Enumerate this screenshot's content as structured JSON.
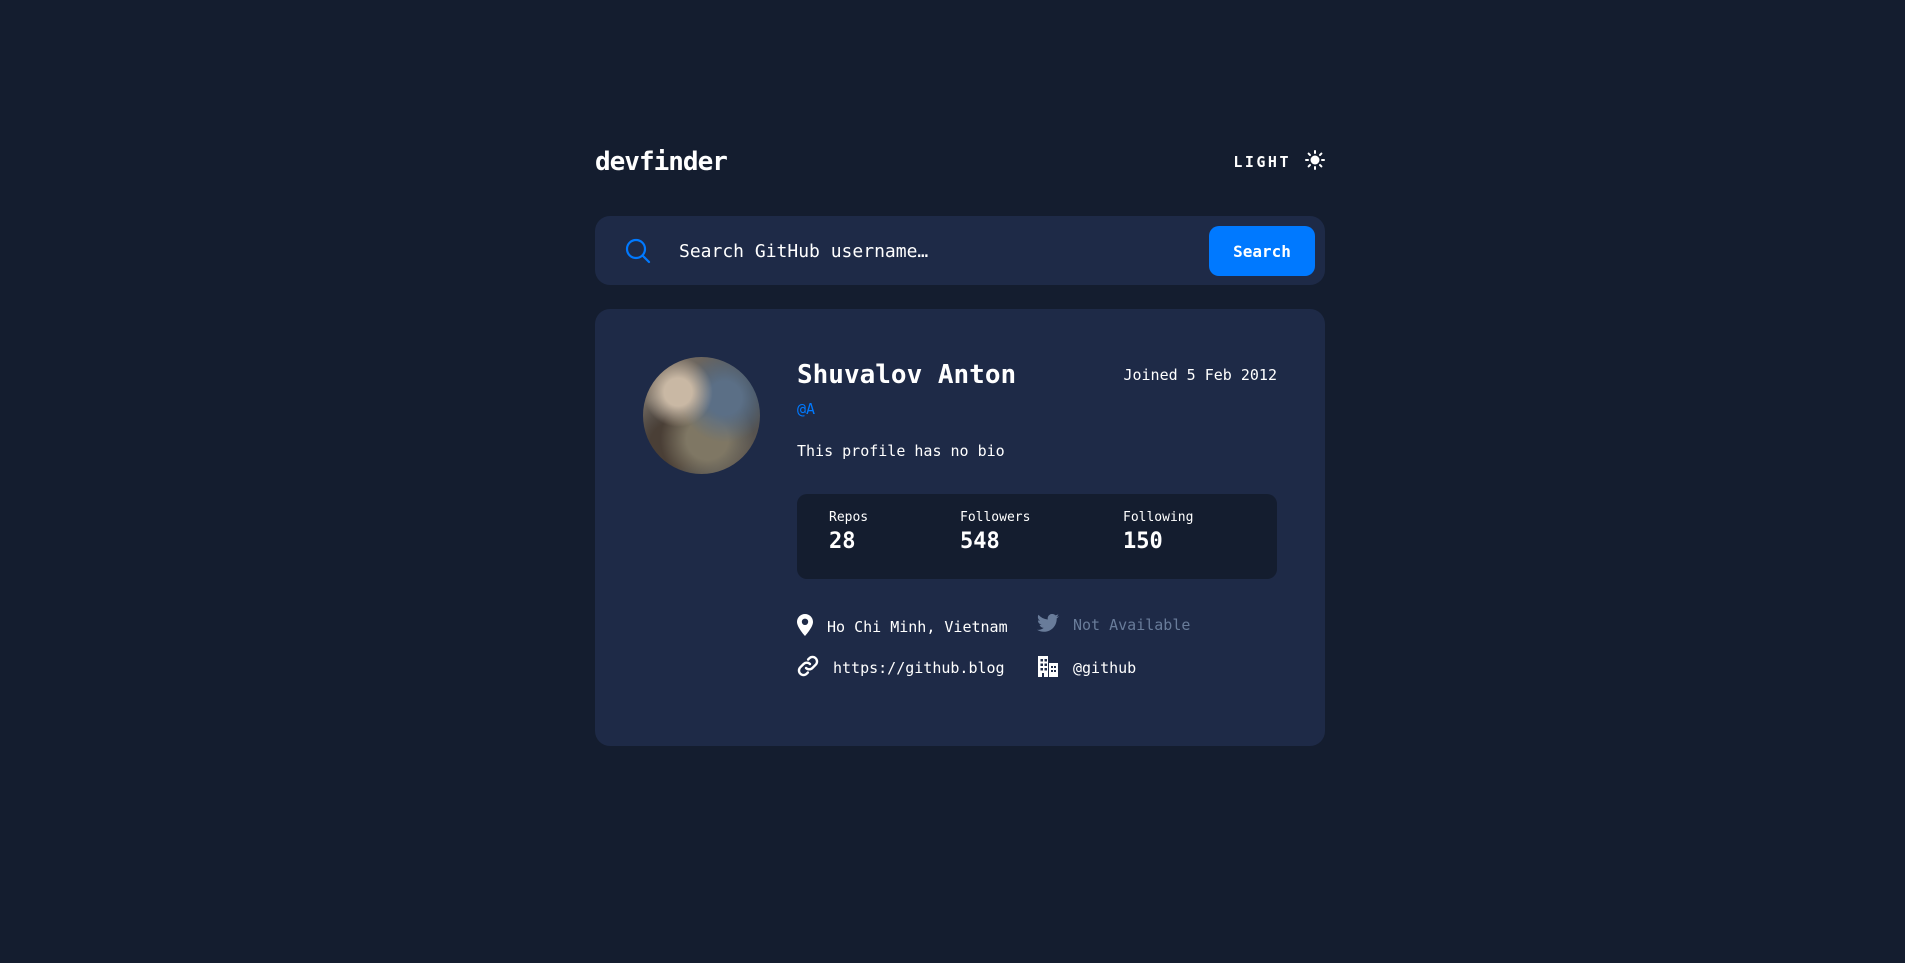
{
  "header": {
    "logo": "devfinder",
    "theme_label": "LIGHT"
  },
  "search": {
    "placeholder": "Search GitHub username…",
    "button_label": "Search"
  },
  "profile": {
    "name": "Shuvalov Anton",
    "login": "@A",
    "joined": "Joined 5 Feb 2012",
    "bio": "This profile has no bio",
    "stats": {
      "repos_label": "Repos",
      "repos_value": "28",
      "followers_label": "Followers",
      "followers_value": "548",
      "following_label": "Following",
      "following_value": "150"
    },
    "location": "Ho Chi Minh, Vietnam",
    "twitter": "Not Available",
    "blog": "https://github.blog",
    "company": "@github"
  },
  "colors": {
    "background": "#141d2f",
    "card": "#1e2a47",
    "accent": "#0079ff",
    "muted": "#697c9a"
  },
  "icons": {
    "theme": "sun-icon",
    "search": "search-icon",
    "location": "location-pin-icon",
    "twitter": "twitter-icon",
    "blog": "link-icon",
    "company": "building-icon"
  }
}
